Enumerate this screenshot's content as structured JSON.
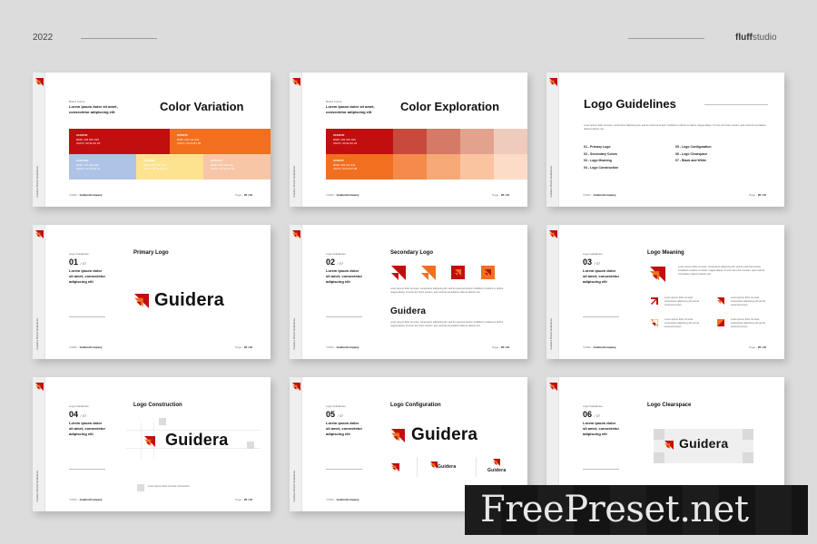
{
  "header": {
    "year": "2022",
    "brand_bold": "fluff",
    "brand_light": "studio"
  },
  "common": {
    "spine_text": "Guidera  Brand Guidelines",
    "footer_left_prefix": "©2022 -",
    "footer_left_name": "GuideraCompany",
    "footer_right_prefix": "Page -",
    "footer_right_page": "26 / 46",
    "eyebrow": "Logo Guidelines",
    "lede": "Lorem ipsum dolor sit amet, consectetur adipiscing elit",
    "lorem": "Lorem ipsum dolor sit amet, consectetur adipiscing elit, sed do eiusmod tempor incididunt ut labore et dolore magna aliqua. Ut enim ad minim veniam, quis nostrud exercitation ullamco laboris nisi.",
    "lorem_short": "Lorem ipsum dolor sit amet, consectetur adipiscing elit sed do eiusmod tempor",
    "brand_word": "Guidera",
    "colors": {
      "red": "#c10f0f",
      "orange": "#f26f1f",
      "blue": "#aec3e6",
      "yellow": "#fde28f",
      "peach": "#f7c6a6"
    }
  },
  "slides": [
    {
      "title": "Color Variation",
      "eyebrow": "Brand Colors",
      "swatches": [
        {
          "name": "#C10F0F",
          "rgb": "RGB: 193 015 015",
          "cmyk": "CMYK: 00 92 92 24",
          "color": "#c10f0f"
        },
        {
          "name": "#F26F1F",
          "rgb": "RGB: 242 111 031",
          "cmyk": "CMYK: 00 54 87 05",
          "color": "#f26f1f"
        },
        {
          "name": "#AEC3E6",
          "rgb": "RGB: 174 195 230",
          "cmyk": "CMYK: 24 15 00 10",
          "color": "#aec3e6"
        },
        {
          "name": "#FDE28F",
          "rgb": "RGB: 253 226 143",
          "cmyk": "CMYK: 00 11 43 01",
          "color": "#fde28f"
        },
        {
          "name": "#F7C6A6",
          "rgb": "RGB: 247 198 166",
          "cmyk": "CMYK: 00 20 33 03",
          "color": "#f7c6a6"
        }
      ]
    },
    {
      "title": "Color Exploration",
      "eyebrow": "Brand Colors",
      "swatches": [
        {
          "name": "#C10F0F",
          "rgb": "RGB: 193 015 015",
          "cmyk": "CMYK: 00 92 92 24"
        },
        {
          "name": "#F26F1F",
          "rgb": "RGB: 242 111 031",
          "cmyk": "CMYK: 00 54 87 05"
        }
      ],
      "red_tints": [
        "#c84a3d",
        "#d57a66",
        "#e2a28e",
        "#eecbbd"
      ],
      "orange_tints": [
        "#f58a4a",
        "#f7a877",
        "#fac4a1",
        "#fcdcc6"
      ]
    },
    {
      "title": "Logo Guidelines",
      "toc": [
        "01 - Primary Logo",
        "02 - Secondary Colors",
        "03 - Logo Meaning",
        "04 - Logo Construction",
        "05 - Logo Configuration",
        "06 - Logo Clearspace",
        "07 - Black and White"
      ]
    },
    {
      "section": "Primary Logo",
      "num": "01",
      "of": "/ 07"
    },
    {
      "section": "Secondary Logo",
      "num": "02",
      "of": "/ 07"
    },
    {
      "section": "Logo Meaning",
      "num": "03",
      "of": "/ 07"
    },
    {
      "section": "Logo Construction",
      "num": "04",
      "of": "/ 07",
      "legend": "Lorem ipsum dolor sit amet consectetur"
    },
    {
      "section": "Logo Configuration",
      "num": "05",
      "of": "/ 07"
    },
    {
      "section": "Logo Clearspace",
      "num": "06",
      "of": "/ 07"
    }
  ],
  "watermark": "FreePreset.net"
}
